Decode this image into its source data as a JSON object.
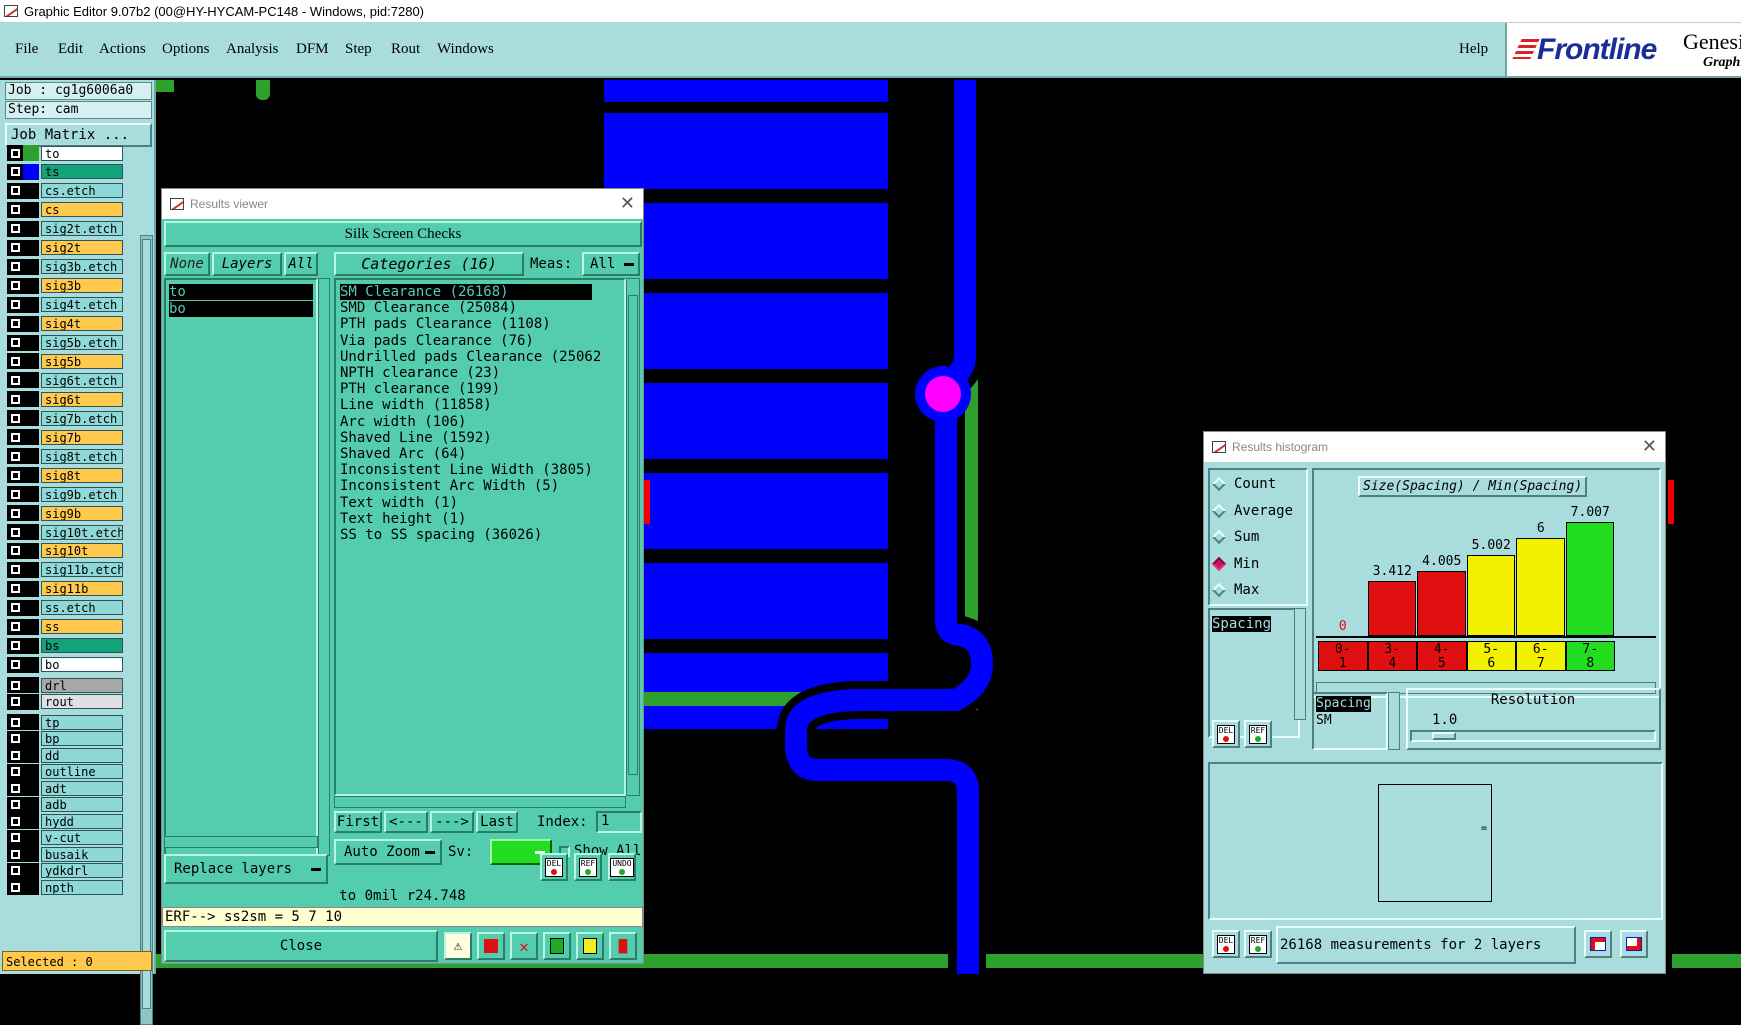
{
  "titlebar": {
    "title": "Graphic Editor 9.07b2 (00@HY-HYCAM-PC148 - Windows, pid:7280)"
  },
  "menu": {
    "items": [
      "File",
      "Edit",
      "Actions",
      "Options",
      "Analysis",
      "DFM",
      "Step",
      "Rout",
      "Windows"
    ],
    "help": "Help"
  },
  "brand": {
    "logo": "Frontline",
    "product": "Genesis",
    "sub": "Graphic"
  },
  "left": {
    "job": "Job : cg1g6006a0",
    "step": "Step: cam",
    "job_matrix": "Job Matrix ...",
    "selected": "Selected : 0",
    "layers": [
      {
        "name": "to",
        "color": "#ffffff",
        "swatch": "#2ea02e"
      },
      {
        "name": "ts",
        "color": "#12a37a",
        "swatch": "#0000ff"
      },
      {
        "name": "cs.etch",
        "color": "#8fd8d8",
        "swatch": "#000000"
      },
      {
        "name": "cs",
        "color": "#ffc94d",
        "swatch": "#000000"
      },
      {
        "name": "sig2t.etch",
        "color": "#8fd8d8",
        "swatch": "#000000"
      },
      {
        "name": "sig2t",
        "color": "#ffc94d",
        "swatch": "#000000"
      },
      {
        "name": "sig3b.etch",
        "color": "#8fd8d8",
        "swatch": "#000000"
      },
      {
        "name": "sig3b",
        "color": "#ffc94d",
        "swatch": "#000000"
      },
      {
        "name": "sig4t.etch",
        "color": "#8fd8d8",
        "swatch": "#000000"
      },
      {
        "name": "sig4t",
        "color": "#ffc94d",
        "swatch": "#000000"
      },
      {
        "name": "sig5b.etch",
        "color": "#8fd8d8",
        "swatch": "#000000"
      },
      {
        "name": "sig5b",
        "color": "#ffc94d",
        "swatch": "#000000"
      },
      {
        "name": "sig6t.etch",
        "color": "#8fd8d8",
        "swatch": "#000000"
      },
      {
        "name": "sig6t",
        "color": "#ffc94d",
        "swatch": "#000000"
      },
      {
        "name": "sig7b.etch",
        "color": "#8fd8d8",
        "swatch": "#000000"
      },
      {
        "name": "sig7b",
        "color": "#ffc94d",
        "swatch": "#000000"
      },
      {
        "name": "sig8t.etch",
        "color": "#8fd8d8",
        "swatch": "#000000"
      },
      {
        "name": "sig8t",
        "color": "#ffc94d",
        "swatch": "#000000"
      },
      {
        "name": "sig9b.etch",
        "color": "#8fd8d8",
        "swatch": "#000000"
      },
      {
        "name": "sig9b",
        "color": "#ffc94d",
        "swatch": "#000000"
      },
      {
        "name": "sig10t.etch",
        "color": "#8fd8d8",
        "swatch": "#000000"
      },
      {
        "name": "sig10t",
        "color": "#ffc94d",
        "swatch": "#000000"
      },
      {
        "name": "sig11b.etch",
        "color": "#8fd8d8",
        "swatch": "#000000"
      },
      {
        "name": "sig11b",
        "color": "#ffc94d",
        "swatch": "#000000"
      },
      {
        "name": "ss.etch",
        "color": "#8fd8d8",
        "swatch": "#000000"
      },
      {
        "name": "ss",
        "color": "#ffc94d",
        "swatch": "#000000"
      },
      {
        "name": "bs",
        "color": "#12a37a",
        "swatch": "#000000"
      },
      {
        "name": "bo",
        "color": "#ffffff",
        "swatch": "#000000"
      },
      {
        "name": "drl",
        "color": "#a8a8a8",
        "swatch": "#000000"
      },
      {
        "name": "rout",
        "color": "#e0e0e0",
        "swatch": "#000000"
      },
      {
        "name": "tp",
        "color": "#8fd8d8",
        "swatch": "#000000"
      },
      {
        "name": "bp",
        "color": "#8fd8d8",
        "swatch": "#000000"
      },
      {
        "name": "dd",
        "color": "#8fd8d8",
        "swatch": "#000000"
      },
      {
        "name": "outline",
        "color": "#8fd8d8",
        "swatch": "#000000"
      },
      {
        "name": "adt",
        "color": "#8fd8d8",
        "swatch": "#000000"
      },
      {
        "name": "adb",
        "color": "#8fd8d8",
        "swatch": "#000000"
      },
      {
        "name": "hydd",
        "color": "#8fd8d8",
        "swatch": "#000000"
      },
      {
        "name": "v-cut",
        "color": "#8fd8d8",
        "swatch": "#000000"
      },
      {
        "name": "busaik",
        "color": "#8fd8d8",
        "swatch": "#000000"
      },
      {
        "name": "ydkdrl",
        "color": "#8fd8d8",
        "swatch": "#000000"
      },
      {
        "name": "npth",
        "color": "#8fd8d8",
        "swatch": "#000000"
      }
    ]
  },
  "results_viewer": {
    "title": "Results viewer",
    "header": "Silk Screen Checks",
    "none_btn": "None",
    "layers_btn": "Layers",
    "all_btn": "All",
    "categories_btn": "Categories (16)",
    "meas_label": "Meas:",
    "meas_value": "All",
    "layers": [
      "to",
      "bo"
    ],
    "categories": [
      "SM Clearance (26168)",
      "SMD Clearance (25084)",
      "PTH pads Clearance (1108)",
      "Via pads Clearance (76)",
      "Undrilled pads Clearance (25062",
      "NPTH clearance (23)",
      "PTH clearance (199)",
      "Line width (11858)",
      "Arc width (106)",
      "Shaved Line (1592)",
      "Shaved Arc (64)",
      "Inconsistent Line Width (3805)",
      "Inconsistent Arc Width (5)",
      "Text width (1)",
      "Text height (1)",
      "SS to SS spacing (36026)"
    ],
    "nav": {
      "first": "First",
      "prev": "<---",
      "next": "--->",
      "last": "Last",
      "index_label": "Index:",
      "index_value": "1"
    },
    "auto_zoom": "Auto Zoom",
    "sv_label": "Sv:",
    "show_all": "Show All",
    "replace_layers": "Replace layers",
    "status": "to 0mil  r24.748",
    "erf": "ERF--> ss2sm = 5 7 10",
    "close": "Close",
    "mini_del": "DEL",
    "mini_ref": "REF",
    "mini_undo": "UNDO"
  },
  "histogram": {
    "title": "Results histogram",
    "options": [
      "Count",
      "Average",
      "Sum",
      "Min",
      "Max"
    ],
    "selected_option": "Min",
    "heading": "Size(Spacing) / Min(Spacing)",
    "spacing_list": [
      "Spacing"
    ],
    "list2": [
      "Spacing",
      "SM"
    ],
    "resolution_label": "Resolution",
    "resolution_value": "1.0",
    "summary": "26168 measurements for 2 layers",
    "mini_del": "DEL",
    "mini_ref": "REF"
  },
  "chart_data": {
    "type": "bar",
    "title": "Size(Spacing) / Min(Spacing)",
    "categories": [
      "0-1",
      "3-4",
      "4-5",
      "5-6",
      "6-7",
      "7-8"
    ],
    "values": [
      0,
      3.412,
      4.005,
      5.002,
      6,
      7.007
    ],
    "value_labels": [
      "0",
      "3.412",
      "4.005",
      "5.002",
      "6",
      "7.007"
    ],
    "colors": [
      "#e01010",
      "#e01010",
      "#e01010",
      "#f2f200",
      "#f2f200",
      "#22dd22"
    ],
    "ylim": [
      0,
      7.5
    ]
  }
}
